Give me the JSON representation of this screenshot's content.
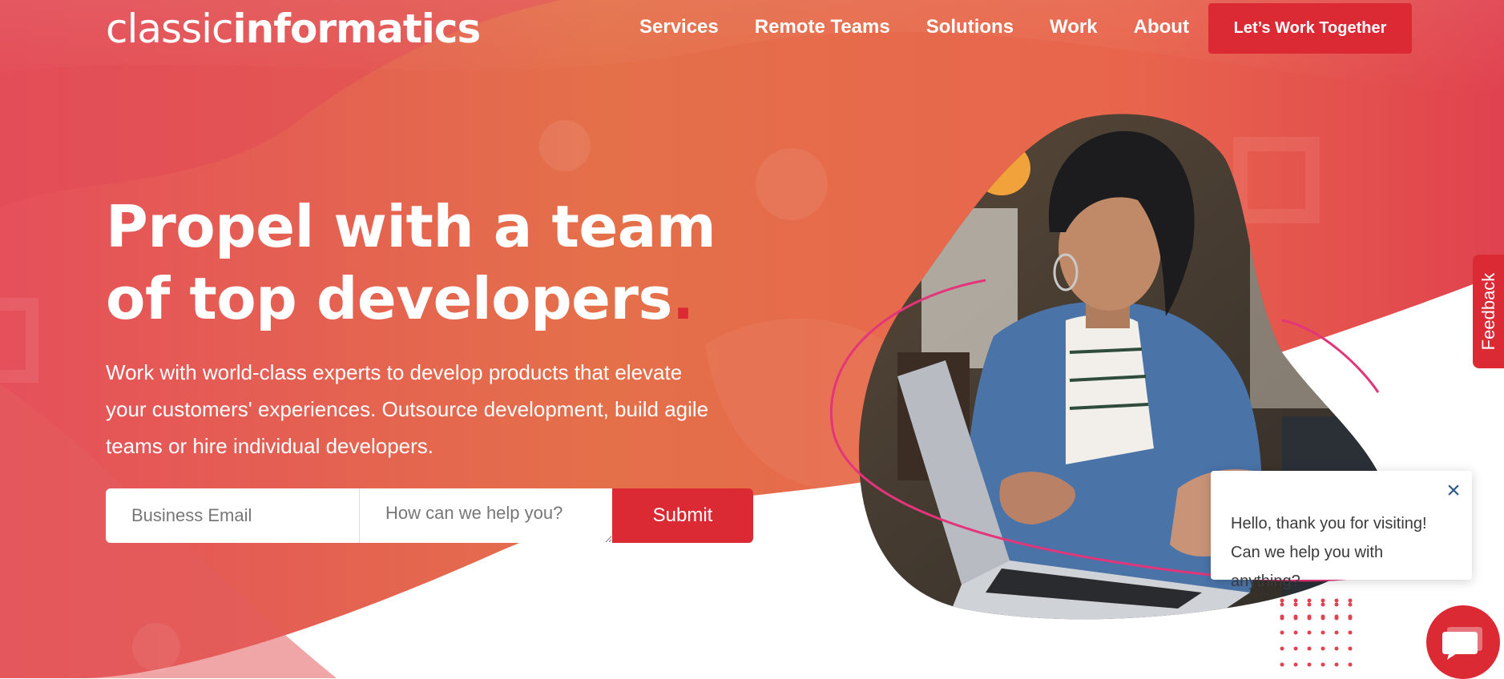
{
  "brand": {
    "logo_light": "classic",
    "logo_bold": "informatics",
    "accent_color": "#dc2a35"
  },
  "nav": {
    "items": [
      {
        "label": "Services"
      },
      {
        "label": "Remote Teams"
      },
      {
        "label": "Solutions"
      },
      {
        "label": "Work"
      },
      {
        "label": "About"
      }
    ],
    "cta_label": "Let’s Work Together"
  },
  "hero": {
    "title_line1": "Propel with a team",
    "title_line2": "of top developers",
    "title_dot": ".",
    "description": "Work with world-class experts to develop products that elevate your customers' experiences. Outsource development, build agile teams or hire individual developers."
  },
  "form": {
    "email_placeholder": "Business Email",
    "message_placeholder": "How can we help you?",
    "submit_label": "Submit"
  },
  "feedback": {
    "label": "Feedback"
  },
  "chat": {
    "message": "Hello, thank you for visiting! Can we help you with anything?",
    "close_icon": "close-icon",
    "launcher_icon": "chat-icon"
  }
}
